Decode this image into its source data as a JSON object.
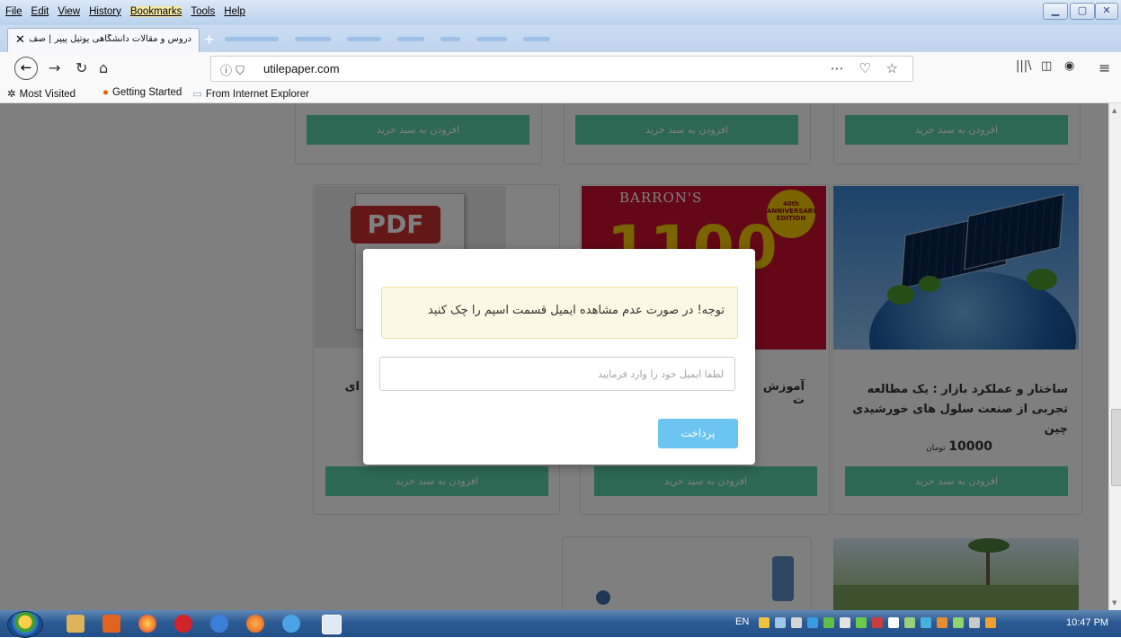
{
  "menu": [
    "File",
    "Edit",
    "View",
    "History",
    "Bookmarks",
    "Tools",
    "Help"
  ],
  "tab": {
    "title": "دروس و مقالات دانشگاهی یوتیل پیپر | صف"
  },
  "address": {
    "url": "utilepaper.com"
  },
  "bookmarks": [
    "Most Visited",
    "Getting Started",
    "From Internet Explorer"
  ],
  "products": {
    "add_to_cart": "افزودن به سبد خرید",
    "solar_title": "ساختار و عملکرد بازار : یک مطالعه تجربی از صنعت سلول های خورشیدی چین",
    "middle_title": "آموزش ت",
    "left_title": "ای",
    "price_value": "10000",
    "price_unit": "تومان",
    "pdf_label": "PDF",
    "barrons_brand": "BARRON'S",
    "barrons_number": "1100",
    "barrons_badge": "40th ANNIVERSARY EDITION"
  },
  "modal": {
    "notice": "توجه! در صورت عدم مشاهده ایمیل قسمت اسپم را چک کنید",
    "email_placeholder": "لطفا ایمیل خود را وارد فرمایید",
    "pay_button": "پرداخت"
  },
  "taskbar": {
    "lang": "EN",
    "clock": "10:47 PM"
  },
  "colors": {
    "cart_button": "#5bd1a8",
    "pay_button": "#6cc4f1",
    "notice_bg": "#fcf8e3"
  }
}
